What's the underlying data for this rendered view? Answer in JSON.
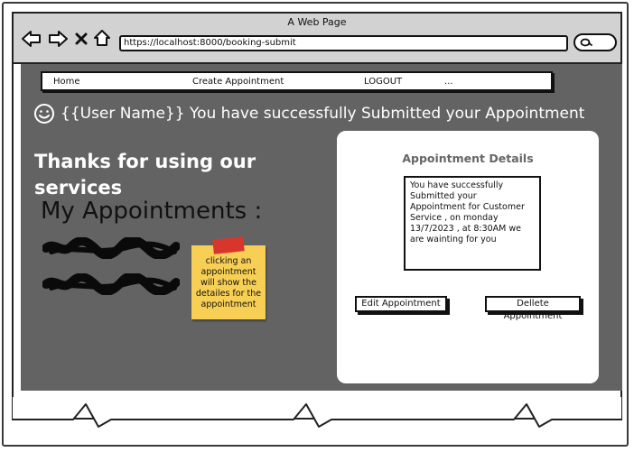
{
  "browser": {
    "title": "A Web Page",
    "url": "https://localhost:8000/booking-submit"
  },
  "nav": {
    "home": "Home",
    "create_appointment": "Create Appointment",
    "logout": "LOGOUT",
    "more": "..."
  },
  "success_message": "{{User Name}} You have successfully Submitted your Appointment",
  "thanks_heading": "Thanks for using our services",
  "my_appointments_heading": "My Appointments :",
  "sticky_note": "clicking an appointment will show the detailes for the appointment",
  "details_panel": {
    "title": "Appointment Details",
    "body": "You have successfully Submitted your Appointment for Customer Service , on monday 13/7/2023 , at 8:30AM we are wainting for you",
    "edit_button": "Edit Appointment",
    "delete_button": "Dellete Appointment"
  },
  "icons": {
    "back": "back-arrow-icon",
    "forward": "forward-arrow-icon",
    "stop": "close-icon",
    "home": "home-icon",
    "search": "search-icon",
    "smiley": "smiley-icon"
  },
  "colors": {
    "content_bg": "#636363",
    "titlebar_bg": "#d2d2d2",
    "sticky_note": "#f7cf55",
    "sticky_tape": "#d8362d"
  }
}
